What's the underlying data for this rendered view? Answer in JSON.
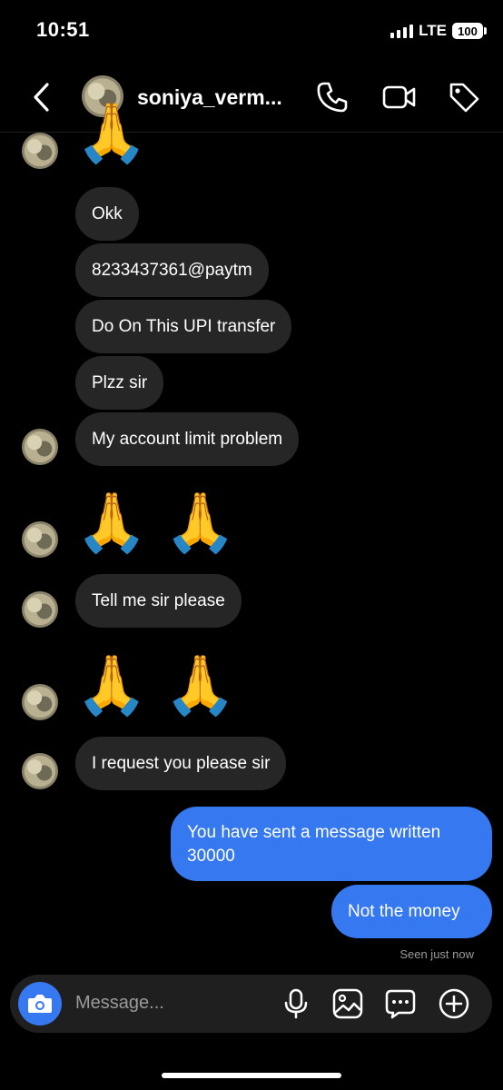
{
  "status": {
    "time": "10:51",
    "network": "LTE",
    "battery": "100"
  },
  "header": {
    "username": "soniya_verm...",
    "icons": [
      "back-chevron-icon",
      "phone-icon",
      "video-icon",
      "tag-icon"
    ]
  },
  "messages": {
    "top_emoji": "🙏",
    "okk": "Okk",
    "upi": "8233437361@paytm",
    "do_upi": "Do On This UPI transfer",
    "plzz": "Plzz sir",
    "limit": "My account limit problem",
    "emoji_pair_1": "🙏 🙏",
    "tell_me": "Tell me sir please",
    "emoji_pair_2": "🙏 🙏",
    "request": "I request you please sir",
    "sent_1": "You have sent a message written 30000",
    "sent_2": "Not the money",
    "seen": "Seen just now"
  },
  "composer": {
    "placeholder": "Message..."
  },
  "colors": {
    "background": "#000000",
    "incoming_bubble": "#262626",
    "outgoing_bubble": "#3578f0"
  }
}
